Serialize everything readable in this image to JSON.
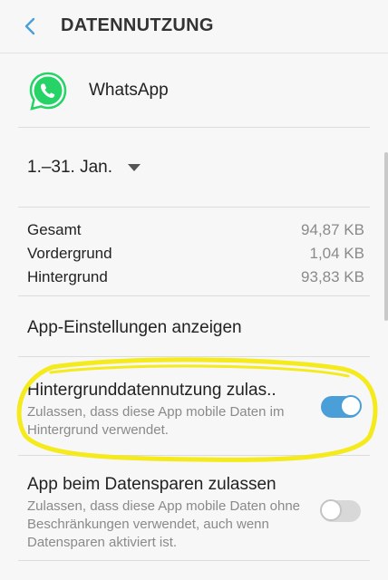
{
  "header": {
    "title": "DATENNUTZUNG",
    "back_icon": "back-arrow-icon"
  },
  "app": {
    "name": "WhatsApp",
    "icon": "whatsapp-icon",
    "color": "#25d366"
  },
  "period": {
    "label": "1.–31. Jan.",
    "icon": "dropdown-caret-icon"
  },
  "usage": [
    {
      "label": "Gesamt",
      "value": "94,87 KB"
    },
    {
      "label": "Vordergrund",
      "value": "1,04 KB"
    },
    {
      "label": "Hintergrund",
      "value": "93,83 KB"
    }
  ],
  "app_settings_link": "App-Einstellungen anzeigen",
  "background_data": {
    "title": "Hintergrunddatennutzung zulas..",
    "description": "Zulassen, dass diese App mobile Daten im Hintergrund verwendet.",
    "enabled": true
  },
  "data_saver": {
    "title": "App beim Datensparen zulassen",
    "description": "Zulassen, dass diese App mobile Daten ohne Beschränkungen verwendet, auch wenn Datensparen aktiviert ist.",
    "enabled": false
  },
  "colors": {
    "accent": "#4a9fd8",
    "highlight": "#f4ea1c"
  }
}
